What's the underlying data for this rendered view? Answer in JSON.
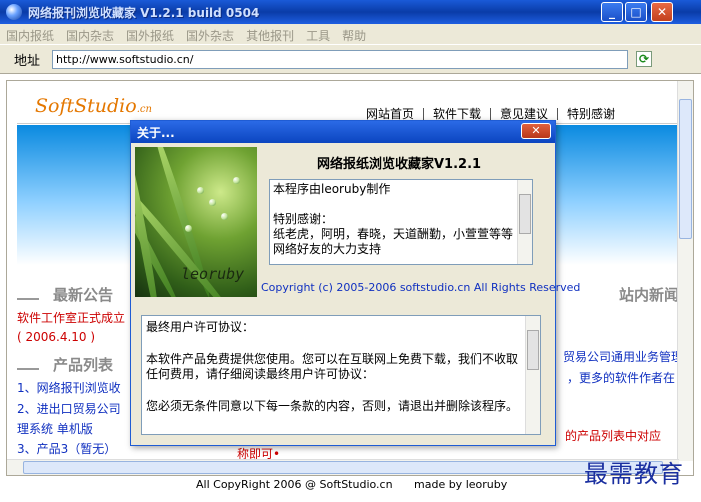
{
  "window": {
    "title": "网络报刊浏览收藏家 V1.2.1 build 0504",
    "buttons": {
      "minimize": "_",
      "maximize": "□",
      "close": "✕"
    }
  },
  "menu": [
    "国内报纸",
    "国内杂志",
    "国外报纸",
    "国外杂志",
    "其他报刊",
    "工具",
    "帮助"
  ],
  "address_bar": {
    "label": "地址",
    "value": "http://www.softstudio.cn/"
  },
  "page": {
    "logo": "SoftStudio",
    "logo_suffix": ".cn",
    "nav": [
      "网站首页",
      "软件下载",
      "意见建议",
      "特别感谢"
    ],
    "news_heading": "最新公告",
    "news_line": "软件工作室正式成立",
    "news_date": "( 2006.4.10 )",
    "products_heading": "产品列表",
    "products": [
      "1、网络报刊浏览收",
      "2、进出口贸易公司",
      "理系统 单机版",
      "3、产品3（暂无）"
    ],
    "site_news_heading": "站内新闻",
    "right_line_1": "贸易公司通用业务管理",
    "right_line_2": "，更多的软件作者在",
    "right_line_3": "的产品列表中对应",
    "bottom_partial": "称即可•",
    "footer_copyright": "All CopyRight 2006 @ SoftStudio.cn",
    "footer_made_by": "made by leoruby"
  },
  "watermark": "最需教育",
  "about_dialog": {
    "title": "关于...",
    "close": "✕",
    "app_title": "网络报纸浏览收藏家V1.2.1",
    "signature": "leoruby",
    "info_lines": [
      "本程序由leoruby制作",
      "",
      "特别感谢：",
      "纸老虎，阿明，春晓，天道酬勤，小萱萱等等",
      "网络好友的大力支持"
    ],
    "copyright": "Copyright (c) 2005-2006 softstudio.cn  All Rights Reserved",
    "license_lines": [
      "最终用户许可协议：",
      "",
      "本软件产品免费提供您使用。您可以在互联网上免费下载，我们不收取任何费用，请仔细阅读最终用户许可协议：",
      "",
      "您必须无条件同意以下每一条款的内容，否则，请退出并删除该程序。"
    ]
  },
  "colors": {
    "title_blue": "#0a3ca8",
    "logo_orange": "#e47700",
    "news_red": "#cc0000",
    "link_blue": "#1030c0"
  }
}
